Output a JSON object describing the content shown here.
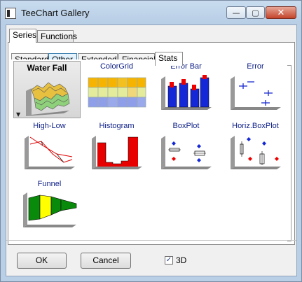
{
  "window": {
    "title": "TeeChart Gallery"
  },
  "top_tabs": [
    "Series",
    "Functions"
  ],
  "sub_tabs": [
    "Standard",
    "Other",
    "Extended",
    "Financial",
    "Stats"
  ],
  "gallery": [
    {
      "label": "Water Fall",
      "icon": "waterfall-chart-icon"
    },
    {
      "label": "ColorGrid",
      "icon": "colorgrid-chart-icon"
    },
    {
      "label": "Error Bar",
      "icon": "errorbar-chart-icon"
    },
    {
      "label": "Error",
      "icon": "error-chart-icon"
    },
    {
      "label": "High-Low",
      "icon": "highlow-chart-icon"
    },
    {
      "label": "Histogram",
      "icon": "histogram-chart-icon"
    },
    {
      "label": "BoxPlot",
      "icon": "boxplot-chart-icon"
    },
    {
      "label": "Horiz.BoxPlot",
      "icon": "horiz-boxplot-chart-icon"
    },
    {
      "label": "Funnel",
      "icon": "funnel-chart-icon"
    }
  ],
  "buttons": {
    "ok": "OK",
    "cancel": "Cancel"
  },
  "checkbox_3d": {
    "label": "3D",
    "checked": true
  },
  "colors": {
    "title_bar": "#b9cfe6",
    "close_button": "#c3442b",
    "label_blue": "#0c1e86"
  }
}
